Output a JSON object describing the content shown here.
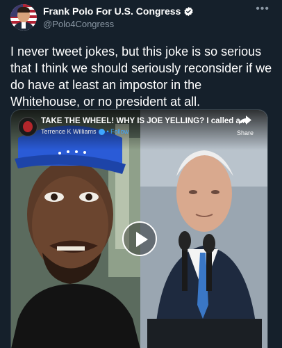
{
  "tweet": {
    "display_name": "Frank Polo For U.S. Congress",
    "handle": "@Polo4Congress",
    "text": "I never tweet jokes, but this joke is so serious that I think we should seriously reconsider if we do have at least an impostor in the Whitehouse, or no president at all.",
    "avatar_icon": "profile-avatar-flag",
    "verified_icon": "verified-badge-icon",
    "more_icon": "more-options-icon"
  },
  "video": {
    "title": "TAKE THE WHEEL! WHY IS JOE YELLING? I called a...",
    "channel": "Terrence K Williams",
    "follow_label": "• Follow",
    "share_label": "Share",
    "play_icon": "play-icon",
    "share_icon": "share-arrow-icon"
  },
  "colors": {
    "background": "#15202b",
    "secondary_text": "#8b98a5",
    "verified_badge": "#1d9bf0",
    "follow_link": "#3ea6ff"
  }
}
